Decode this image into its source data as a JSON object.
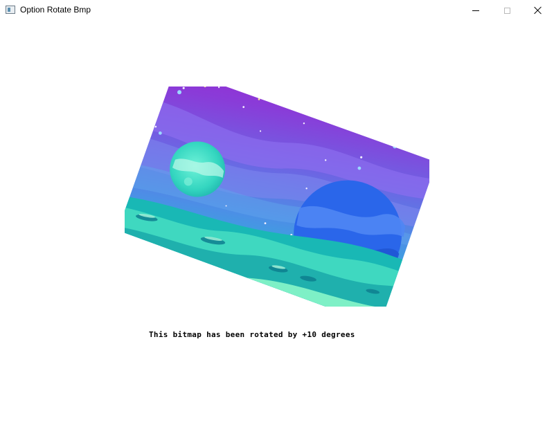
{
  "window": {
    "title": "Option Rotate Bmp",
    "icon": "app-window-icon",
    "controls": {
      "minimize": "minimize-icon",
      "maximize": "maximize-icon",
      "close": "close-icon"
    }
  },
  "bitmap": {
    "rotation_degrees": 10,
    "scene": "pixel-art space landscape with two planets and starry purple sky",
    "colors": {
      "sky_top": "#9a2ad0",
      "sky_mid": "#6a5fe0",
      "sky_low": "#3aa6e0",
      "ground_light": "#7ef0c6",
      "ground_dark": "#1ac0b0",
      "planet_small": "#3ee0c2",
      "planet_large": "#2f6ff0"
    }
  },
  "caption": {
    "text": "This bitmap has been rotated by +10 degrees"
  }
}
